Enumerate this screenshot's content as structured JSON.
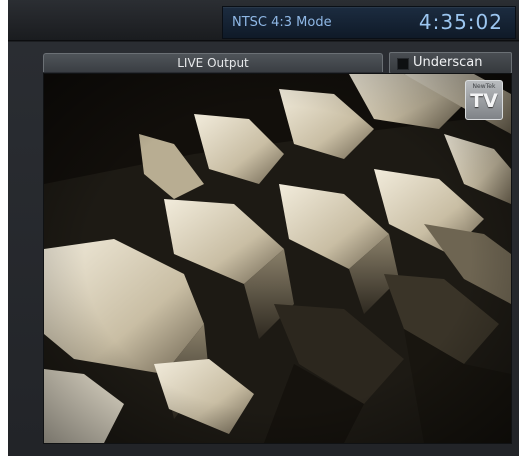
{
  "header": {
    "mode": "NTSC 4:3 Mode",
    "clock": "4:35:02"
  },
  "monitor": {
    "title": "LIVE Output",
    "underscan": {
      "label": "Underscan",
      "checked": false
    }
  },
  "overlay": {
    "badge_small": "NewTek",
    "badge_big": "TV"
  },
  "colors": {
    "panel_bg": "#1c1e21",
    "clock_text": "#9cc6f0",
    "mode_panel_bg": "#0f1a28"
  }
}
